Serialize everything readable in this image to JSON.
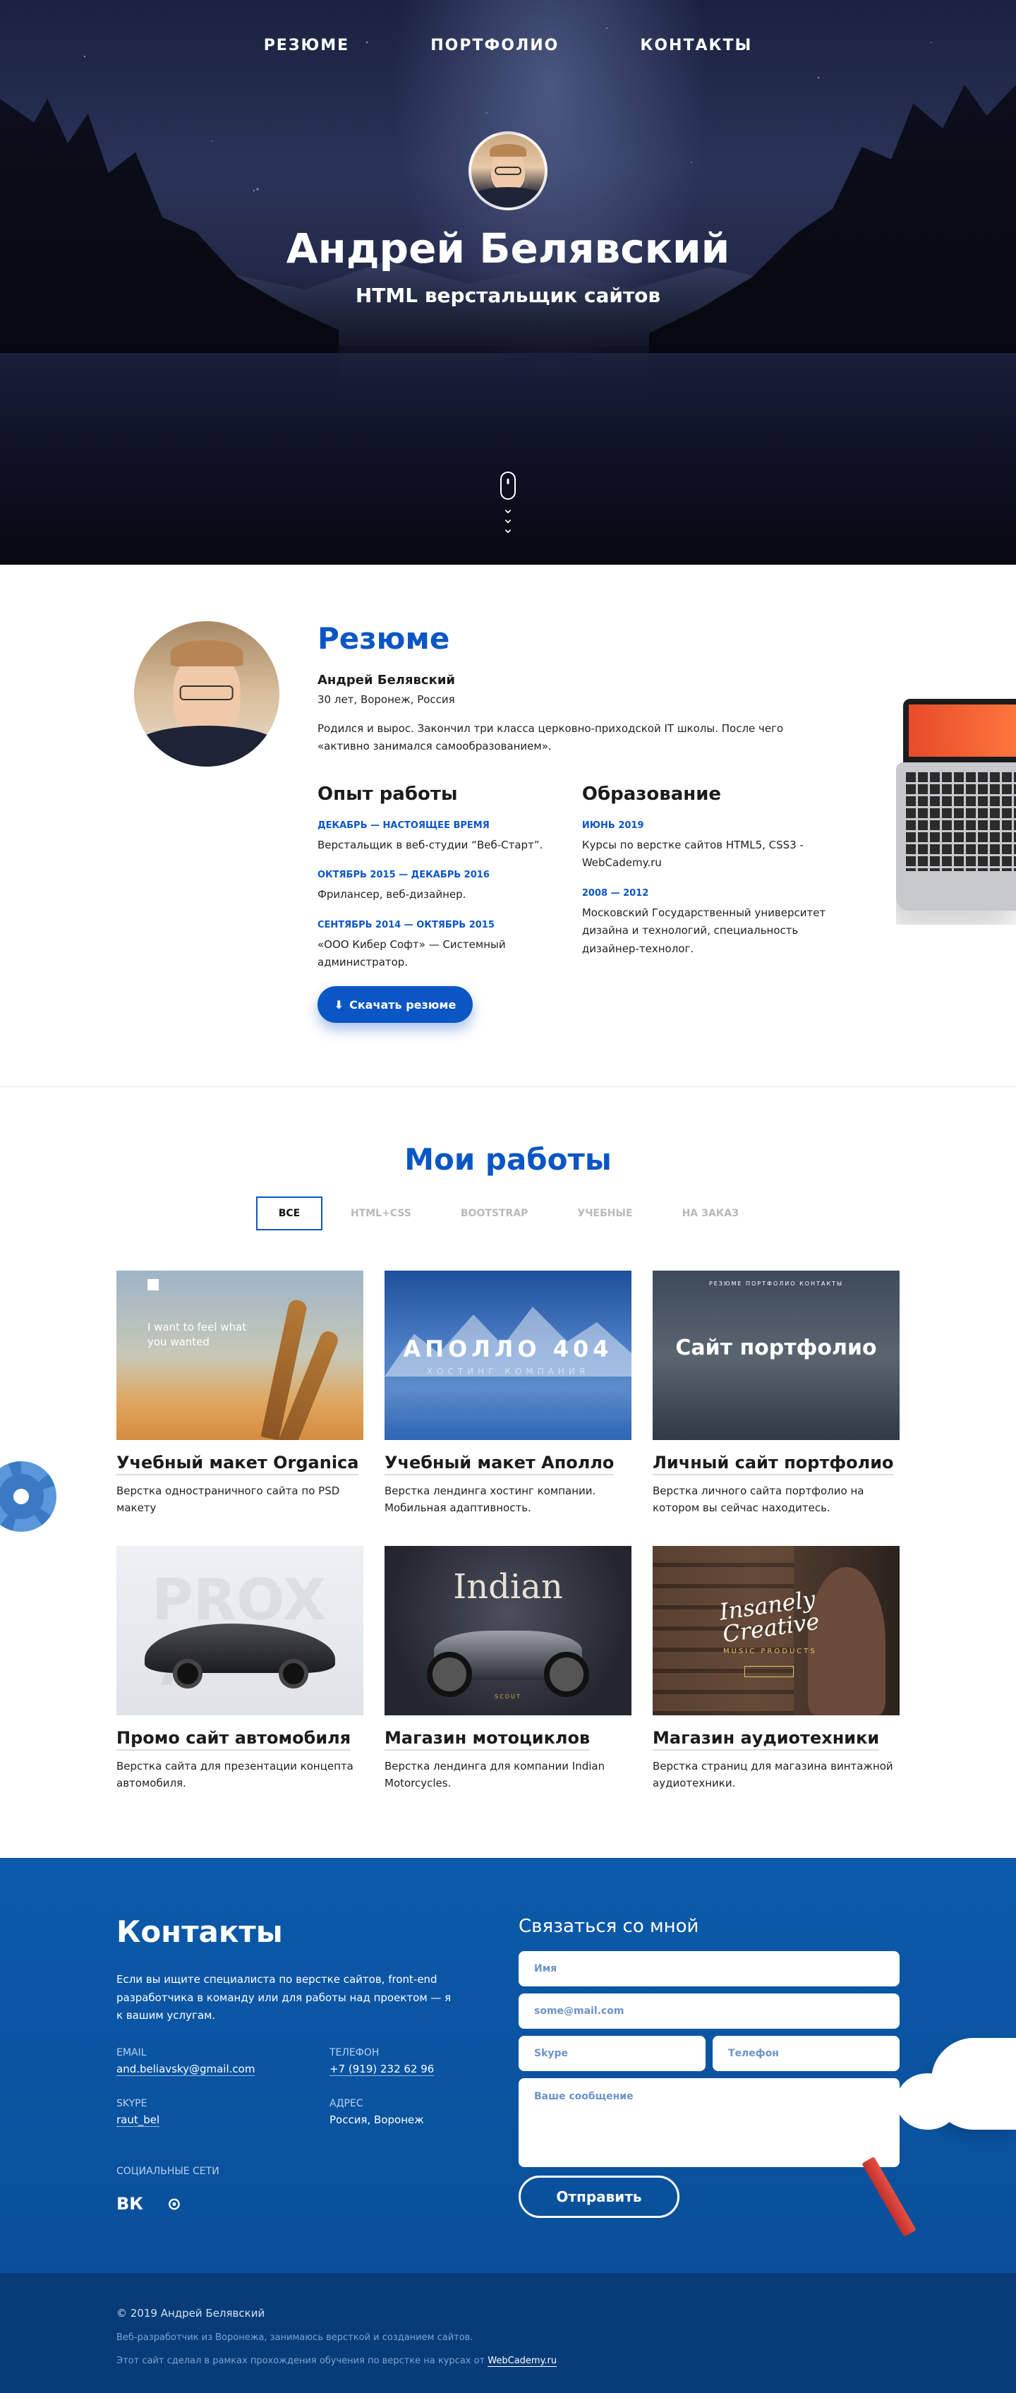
{
  "nav": {
    "items": [
      {
        "label": "РЕЗЮМЕ"
      },
      {
        "label": "ПОРТФОЛИО"
      },
      {
        "label": "КОНТАКТЫ"
      }
    ]
  },
  "hero": {
    "name": "Андрей Белявский",
    "role": "HTML верстальщик сайтов"
  },
  "resume": {
    "title": "Резюме",
    "name": "Андрей Белявский",
    "meta": "30 лет, Воронеж, Россия",
    "bio": "Родился и вырос. Закончил три класса церковно-приходской IT школы. После чего «активно занимался самообразованием».",
    "experience": {
      "title": "Опыт работы",
      "items": [
        {
          "date": "ДЕКАБРЬ — НАСТОЯЩЕЕ ВРЕМЯ",
          "desc": "Верстальщик в веб-студии “Веб-Старт”."
        },
        {
          "date": "ОКТЯБРЬ 2015 — ДЕКАБРЬ 2016",
          "desc": "Фрилансер, веб-дизайнер."
        },
        {
          "date": "СЕНТЯБРЬ 2014 — ОКТЯБРЬ 2015",
          "desc": "«ООО Кибер Софт» — Системный администратор."
        }
      ]
    },
    "education": {
      "title": "Образование",
      "items": [
        {
          "date": "ИЮНЬ 2019",
          "desc": "Курсы по верстке сайтов HTML5, CSS3 - WebCademy.ru"
        },
        {
          "date": "2008 — 2012",
          "desc": "Московский Государственный университет дизайна и технологий, специальность дизайнер-технолог."
        }
      ]
    },
    "download_label": "Скачать резюме"
  },
  "works": {
    "title": "Мои работы",
    "filters": [
      {
        "label": "ВСЕ",
        "active": true
      },
      {
        "label": "HTML+CSS"
      },
      {
        "label": "BOOTSTRAP"
      },
      {
        "label": "УЧЕБНЫЕ"
      },
      {
        "label": "НА ЗАКАЗ"
      }
    ],
    "cards": [
      {
        "title": "Учебный макет Organica",
        "desc": "Верстка одностраничного сайта по PSD макету",
        "thumb_text": "I want to feel what you wanted"
      },
      {
        "title": "Учебный макет Аполло",
        "desc": "Верстка лендинга хостинг компании. Мобильная адаптивность.",
        "thumb_big": "АПОЛЛО 404",
        "thumb_small": "ХОСТИНГ КОМПАНИЯ"
      },
      {
        "title": "Личный сайт портфолио",
        "desc": "Верстка личного сайта портфолио на котором вы сейчас находитесь.",
        "thumb_big": "Сайт портфолио",
        "thumb_menu": "РЕЗЮМЕ   ПОРТФОЛИО   КОНТАКТЫ"
      },
      {
        "title": "Промо сайт автомобиля",
        "desc": "Верстка сайта для презентации концепта автомобиля.",
        "thumb_big": "PROX 7"
      },
      {
        "title": "Магазин мотоциклов",
        "desc": "Верстка лендинга для компании Indian Motorcycles.",
        "thumb_big": "Indian",
        "thumb_small": "SCOUT"
      },
      {
        "title": "Магазин аудиотехники",
        "desc": "Верстка страниц для магазина винтажной аудиотехники.",
        "thumb_big": "Insanely Creative",
        "thumb_small": "MUSIC PRODUCTS"
      }
    ]
  },
  "contacts": {
    "title": "Контакты",
    "intro": "Если вы ищите специалиста по верстке сайтов, front-end разработчика в команду или для работы над проектом — я к вашим услугам.",
    "email_label": "EMAIL",
    "email": "and.beliavsky@gmail.com",
    "phone_label": "ТЕЛЕФОН",
    "phone": "+7 (919) 232 62 96",
    "skype_label": "SKYPE",
    "skype": "raut_bel",
    "address_label": "АДРЕС",
    "address": "Россия, Воронеж",
    "social_label": "СОЦИАЛЬНЫЕ СЕТИ",
    "form_title": "Связаться со мной",
    "form": {
      "name_placeholder": "Имя",
      "email_placeholder": "some@mail.com",
      "skype_placeholder": "Skype",
      "phone_placeholder": "Телефон",
      "message_placeholder": "Ваше сообщение",
      "submit_label": "Отправить"
    }
  },
  "footer": {
    "copyright": "© 2019 Андрей Белявский",
    "about": "Веб-разработчик из Воронежа, занимаюсь версткой и созданием сайтов.",
    "course_text": "Этот сайт сделал в рамках прохождения обучения по верстке на курсах от ",
    "course_link": "WebCademy.ru"
  },
  "colors": {
    "accent": "#0b56c5",
    "contacts_bg": "#0b5aab",
    "footer_bg": "#073c78"
  }
}
